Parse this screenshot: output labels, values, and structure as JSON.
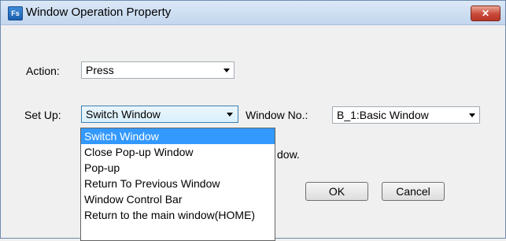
{
  "window": {
    "title": "Window Operation Property",
    "app_icon_text": "Fs",
    "close_glyph": "✕"
  },
  "action": {
    "label": "Action:",
    "value": "Press"
  },
  "setup": {
    "label": "Set Up:",
    "value": "Switch Window",
    "options": [
      "Switch Window",
      "Close Pop-up Window",
      "Pop-up",
      "Return To Previous Window",
      "Window Control Bar",
      "Return to the main window(HOME)"
    ],
    "selected_index": 0
  },
  "window_no": {
    "label": "Window No.:",
    "value": "B_1:Basic Window"
  },
  "partial_text": "dow.",
  "buttons": {
    "ok": "OK",
    "cancel": "Cancel"
  },
  "colors": {
    "selection": "#3399ff",
    "close_button": "#c9493a"
  }
}
